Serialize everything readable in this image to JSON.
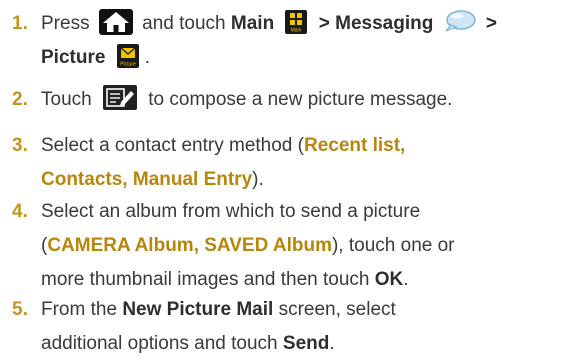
{
  "steps": [
    {
      "num": "1.",
      "line1": {
        "a": "Press",
        "b": "and touch",
        "main": "Main",
        "gt": ">",
        "messaging": "Messaging",
        "gt2": ">"
      },
      "line2": {
        "picture": "Picture",
        "period": "."
      }
    },
    {
      "num": "2.",
      "a": "Touch",
      "b": "to compose a new picture message."
    },
    {
      "num": "3.",
      "a": "Select a contact entry method (",
      "bold1": "Recent list,",
      "bold2": "Contacts, Manual Entry",
      "c": ")."
    },
    {
      "num": "4.",
      "a": "Select an album from which to send a picture",
      "open": "(",
      "bold1": "CAMERA Album, SAVED Album",
      "b": "), touch one or",
      "c": "more thumbnail images and then touch",
      "ok": "OK",
      "period": "."
    },
    {
      "num": "5.",
      "a": "From the",
      "bold1": "New Picture Mail",
      "b": "screen, select",
      "c": "additional options and touch",
      "send": "Send",
      "period": "."
    }
  ],
  "icons": {
    "home": "home-icon",
    "main": "main-menu-icon",
    "messaging": "messaging-bubble-icon",
    "picture": "picture-mail-icon",
    "compose": "compose-icon"
  },
  "icon_labels": {
    "main": "Main",
    "picture": "Picture"
  },
  "colors": {
    "step_number": "#c5961e",
    "highlight": "#b8860b",
    "text": "#3a3a3a",
    "icon_yellow": "#f2c400"
  }
}
